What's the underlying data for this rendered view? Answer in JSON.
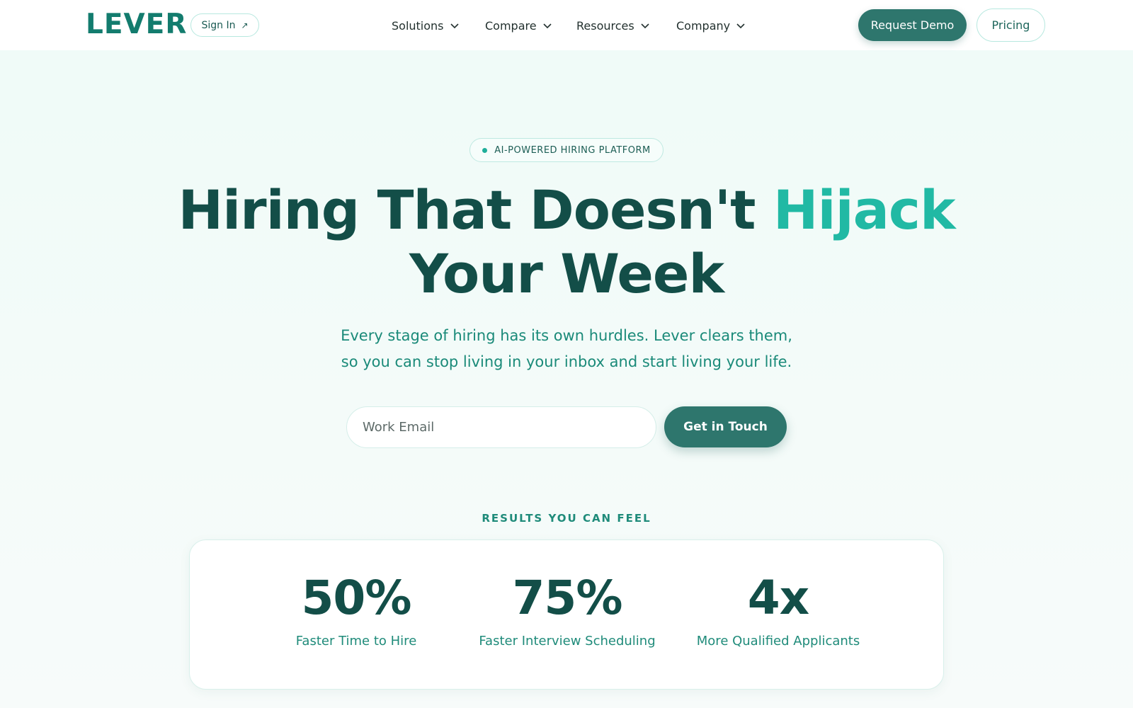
{
  "header": {
    "logo": "LEVER",
    "sign_in": "Sign In",
    "nav": [
      {
        "label": "Solutions"
      },
      {
        "label": "Compare"
      },
      {
        "label": "Resources"
      },
      {
        "label": "Company"
      }
    ],
    "request_demo": "Request Demo",
    "pricing": "Pricing"
  },
  "hero": {
    "badge": "AI-POWERED HIRING PLATFORM",
    "headline_part1": "Hiring That Doesn't",
    "headline_accent": "Hijack",
    "headline_line2": "Your Week",
    "subhead_line1": "Every stage of hiring has its own hurdles. Lever clears them,",
    "subhead_line2": "so you can stop living in your inbox and start living your life.",
    "email_placeholder": "Work Email",
    "cta": "Get in Touch"
  },
  "results": {
    "label": "RESULTS YOU CAN FEEL",
    "stats": [
      {
        "value": "50%",
        "label": "Faster Time to Hire"
      },
      {
        "value": "75%",
        "label": "Faster Interview Scheduling"
      },
      {
        "value": "4x",
        "label": "More Qualified Applicants"
      }
    ]
  },
  "colors": {
    "brand": "#137c6e",
    "button": "#2e766d",
    "accent": "#21b9a4",
    "heading": "#134e48"
  }
}
